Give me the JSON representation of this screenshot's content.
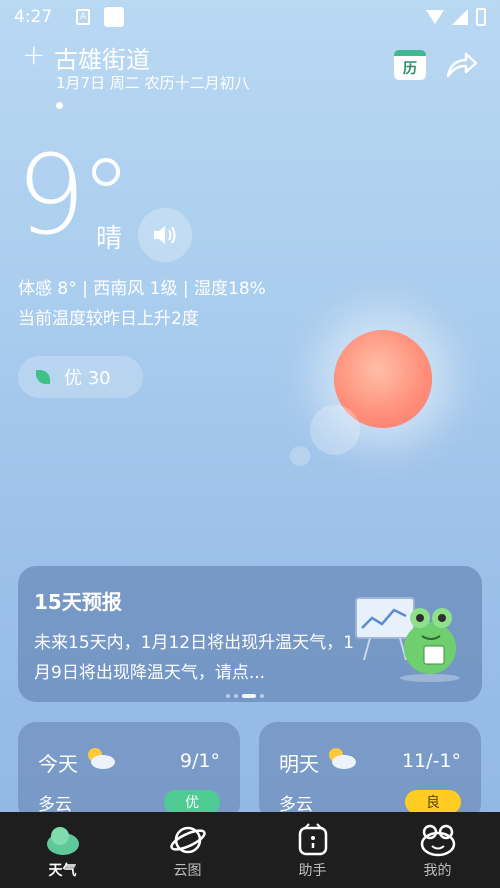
{
  "status_bar": {
    "time": "4:27"
  },
  "header": {
    "location": "古雄街道",
    "date": "1月7日 周二 农历十二月初八",
    "calendar_icon_text": "历"
  },
  "current": {
    "temperature": "9",
    "condition": "晴",
    "details": "体感 8° | 西南风 1级 | 湿度18%",
    "trend": "当前温度较昨日上升2度",
    "aqi": "优 30"
  },
  "forecast": {
    "title": "15天预报",
    "text": "未来15天内，1月12日将出现升温天气，1月9日将出现降温天气，请点..."
  },
  "today": {
    "label": "今天",
    "temp": "9/1°",
    "condition": "多云",
    "aqi": "优"
  },
  "tomorrow": {
    "label": "明天",
    "temp": "11/-1°",
    "condition": "多云",
    "aqi": "良"
  },
  "nav": [
    {
      "label": "天气"
    },
    {
      "label": "云图"
    },
    {
      "label": "助手"
    },
    {
      "label": "我的"
    }
  ],
  "colors": {
    "aqi_good": "#4dcb93",
    "aqi_ok": "#ffcc22",
    "nav_bg": "#1e1e1e"
  }
}
